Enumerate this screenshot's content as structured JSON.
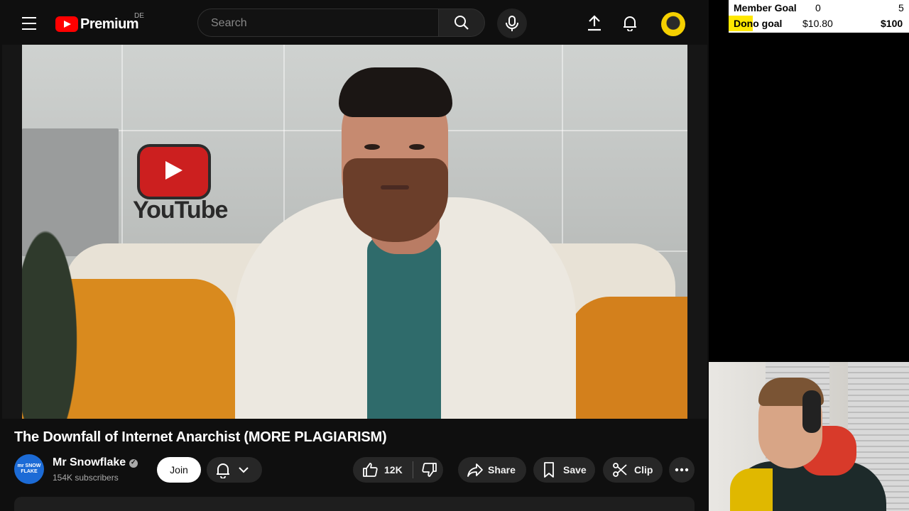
{
  "header": {
    "menu_icon": "hamburger-menu-icon",
    "logo_text": "Premium",
    "region": "DE",
    "search_placeholder": "Search",
    "icons": [
      "search-icon",
      "mic-icon",
      "upload-icon",
      "bell-icon"
    ]
  },
  "video": {
    "title": "The Downfall of Internet Anarchist (MORE PLAGIARISM)",
    "scene_sign_text": "YouTube"
  },
  "channel": {
    "name": "Mr Snowflake",
    "subscribers": "154K subscribers",
    "avatar_text": "mr SNOW FLAKE",
    "join_label": "Join"
  },
  "actions": {
    "likes": "12K",
    "share_label": "Share",
    "save_label": "Save",
    "clip_label": "Clip"
  },
  "stream_overlay": {
    "member_goal_label": "Member Goal",
    "member_goal_current": "0",
    "member_goal_target": "5",
    "dono_goal_label": "Dono goal",
    "dono_goal_current": "$10.80",
    "dono_goal_target": "$100",
    "highlight_color": "#ffe800"
  },
  "colors": {
    "brand_red": "#ff0000",
    "background": "#0f0f0f",
    "pill": "#272727"
  }
}
